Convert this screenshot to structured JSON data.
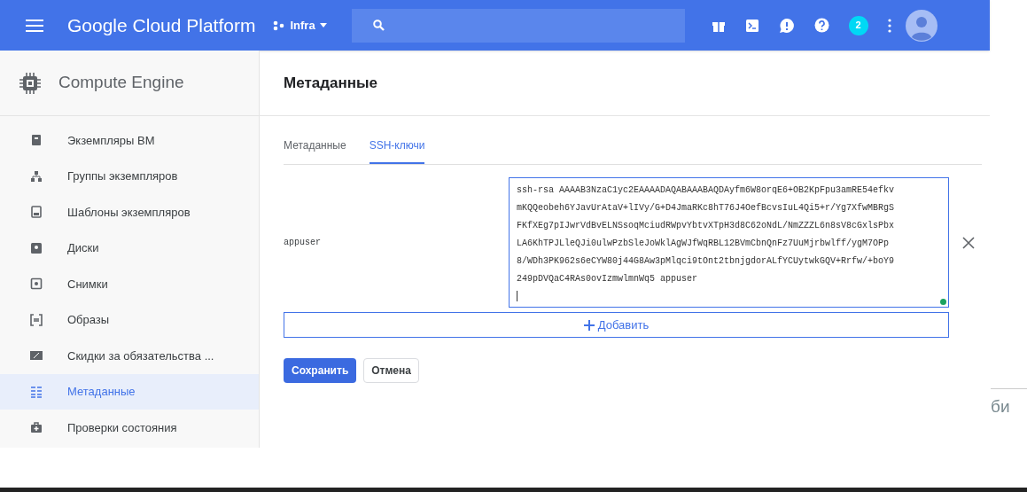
{
  "header": {
    "brand": "Google Cloud Platform",
    "project": "Infra",
    "notifications": "2"
  },
  "sidebar": {
    "title": "Compute Engine",
    "items": [
      {
        "label": "Экземпляры ВМ",
        "selected": false,
        "kind": "vm"
      },
      {
        "label": "Группы экземпляров",
        "selected": false,
        "kind": "group"
      },
      {
        "label": "Шаблоны экземпляров",
        "selected": false,
        "kind": "template"
      },
      {
        "label": "Диски",
        "selected": false,
        "kind": "disk"
      },
      {
        "label": "Снимки",
        "selected": false,
        "kind": "snapshot"
      },
      {
        "label": "Образы",
        "selected": false,
        "kind": "image"
      },
      {
        "label": "Скидки за обязательства ...",
        "selected": false,
        "kind": "discount"
      },
      {
        "label": "Метаданные",
        "selected": true,
        "kind": "metadata"
      },
      {
        "label": "Проверки состояния",
        "selected": false,
        "kind": "health"
      }
    ]
  },
  "page": {
    "title": "Метаданные",
    "tabs": [
      {
        "label": "Метаданные",
        "selected": false
      },
      {
        "label": "SSH-ключи",
        "selected": true
      }
    ],
    "keys": [
      {
        "user": "appuser",
        "value": "ssh-rsa AAAAB3NzaC1yc2EAAAADAQABAAABAQDAyfm6W8orqE6+OB2KpFpu3amRE54efkvmKQQeobeh6YJavUrAtaV+lIVy/G+D4JmaRKc8hT76J4OefBcvsIuL4Qi5+r/Yg7XfwMBRgSFKfXEg7pIJwrVdBvELNSsoqMciudRWpvYbtvXTpH3d8C62oNdL/NmZZZL6n8sV8cGxlsPbxLA6KhTPJLleQJi0ulwPzbSleJoWklAgWJfWqRBL12BVmCbnQnFz7UuMjrbwlff/ygM7OPp8/WDh3PK962s6eCYW80j44G8Aw3pMlqci9tOnt2tbnjgdorALfYCUytwkGQV+Rrfw/+boY9249pDVQaC4RAs0ovIzmwlmnWq5 appuser"
      }
    ],
    "add_button": "Добавить",
    "save_button": "Сохранить",
    "cancel_button": "Отмена"
  },
  "background_text": "би"
}
